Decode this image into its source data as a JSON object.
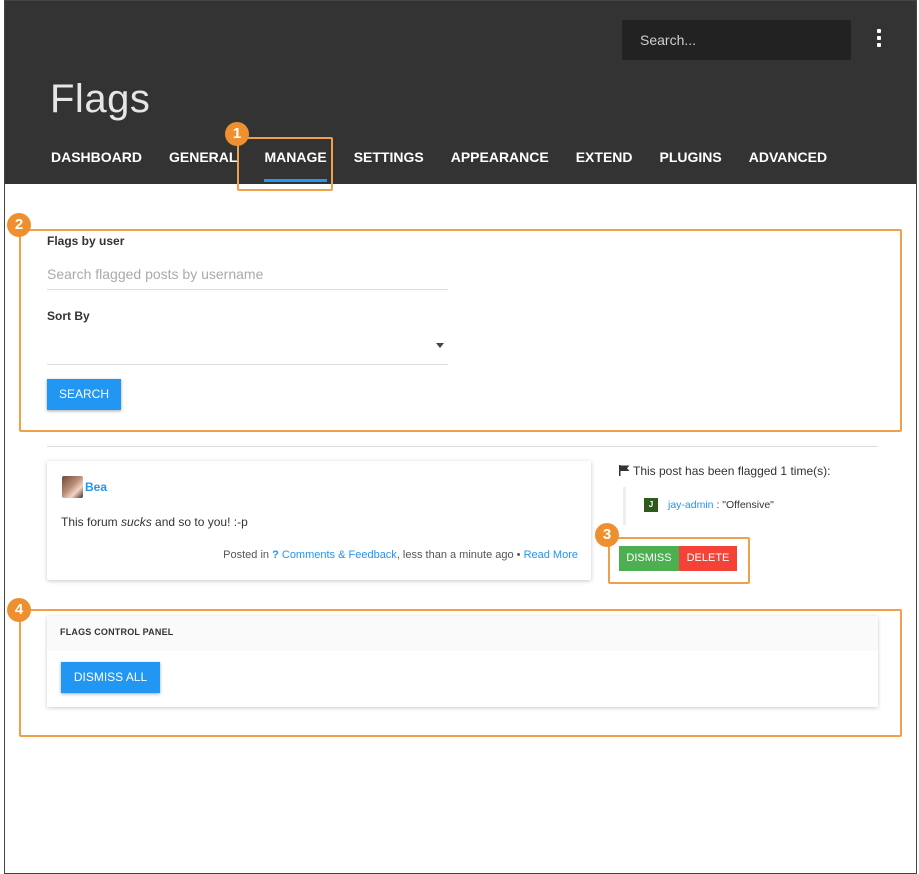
{
  "header": {
    "search_placeholder": "Search...",
    "title": "Flags",
    "tabs": [
      {
        "label": "DASHBOARD"
      },
      {
        "label": "GENERAL"
      },
      {
        "label": "MANAGE",
        "active": true
      },
      {
        "label": "SETTINGS"
      },
      {
        "label": "APPEARANCE"
      },
      {
        "label": "EXTEND"
      },
      {
        "label": "PLUGINS"
      },
      {
        "label": "ADVANCED"
      }
    ],
    "more_icon": "kebab-menu-icon"
  },
  "filter": {
    "user_label": "Flags by user",
    "user_placeholder": "Search flagged posts by username",
    "user_value": "",
    "sort_label": "Sort By",
    "sort_value": "",
    "search_button": "SEARCH"
  },
  "post": {
    "author": "Bea",
    "body_before": "This forum ",
    "body_emphasis": "sucks",
    "body_after": " and so to you! :-p",
    "meta_prefix": "Posted in ",
    "category_icon": "?",
    "category": "Comments & Feedback",
    "meta_time": ", less than a minute ago • ",
    "read_more": "Read More"
  },
  "flag": {
    "summary": "This post has been flagged 1 time(s):",
    "flagger_initial": "J",
    "flagger": "jay-admin",
    "reason": " : \"Offensive\"",
    "dismiss_button": "DISMISS",
    "delete_button": "DELETE"
  },
  "control_panel": {
    "title": "FLAGS CONTROL PANEL",
    "dismiss_all_button": "DISMISS ALL"
  },
  "callouts": [
    "1",
    "2",
    "3",
    "4"
  ],
  "colors": {
    "header_bg": "#333333",
    "accent": "#2196f3",
    "dismiss": "#4caf50",
    "delete": "#f44336",
    "callout": "#ef9030"
  }
}
